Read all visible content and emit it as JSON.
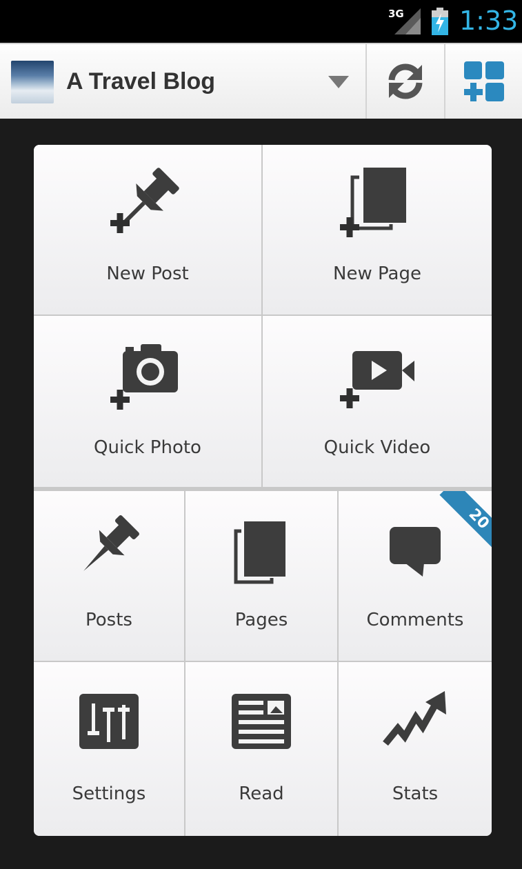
{
  "status_bar": {
    "network": "3G",
    "clock": "1:33",
    "accent_color": "#33b5e5"
  },
  "action_bar": {
    "blog_title": "A Travel Blog",
    "icons": [
      "blog-avatar",
      "dropdown-arrow-icon",
      "refresh-icon",
      "dashboard-add-icon"
    ]
  },
  "dashboard": {
    "large_tiles": [
      {
        "label": "New Post",
        "icon": "new-post-icon"
      },
      {
        "label": "New Page",
        "icon": "new-page-icon"
      },
      {
        "label": "Quick Photo",
        "icon": "quick-photo-icon"
      },
      {
        "label": "Quick Video",
        "icon": "quick-video-icon"
      }
    ],
    "small_tiles": [
      {
        "label": "Posts",
        "icon": "posts-icon"
      },
      {
        "label": "Pages",
        "icon": "pages-icon"
      },
      {
        "label": "Comments",
        "icon": "comments-icon",
        "badge": "20"
      },
      {
        "label": "Settings",
        "icon": "settings-icon"
      },
      {
        "label": "Read",
        "icon": "read-icon"
      },
      {
        "label": "Stats",
        "icon": "stats-icon"
      }
    ],
    "badge_color": "#2d86b8"
  }
}
